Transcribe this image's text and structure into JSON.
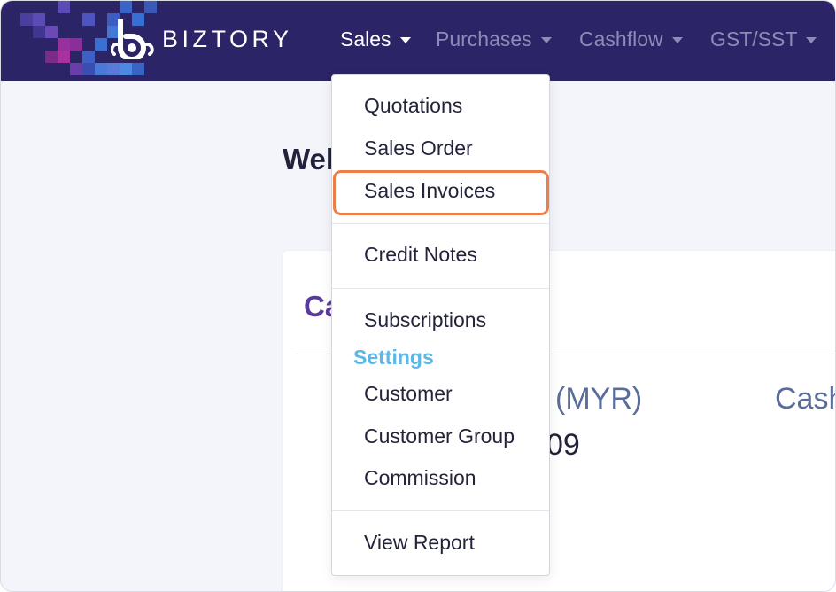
{
  "brand": {
    "name": "BIZTORY",
    "logo_icon": "biztory-b-icon",
    "colors": {
      "navbar": "#2b2466",
      "accent_highlight": "#ec7e4a",
      "settings_header": "#5cb7e6"
    }
  },
  "nav": {
    "items": [
      {
        "label": "Sales",
        "active": true
      },
      {
        "label": "Purchases",
        "active": false
      },
      {
        "label": "Cashflow",
        "active": false
      },
      {
        "label": "GST/SST",
        "active": false
      }
    ],
    "caret_icon": "caret-down-icon"
  },
  "dropdown": {
    "items": [
      {
        "label": "Quotations"
      },
      {
        "label": "Sales Order"
      },
      {
        "label": "Sales Invoices",
        "highlighted": true
      },
      {
        "label": "Credit Notes"
      },
      {
        "label": "Subscriptions"
      }
    ],
    "settings_header": "Settings",
    "settings_items": [
      {
        "label": "Customer"
      },
      {
        "label": "Customer Group"
      },
      {
        "label": "Commission"
      }
    ],
    "report_item": {
      "label": "View Report"
    }
  },
  "background": {
    "welcome_fragment": "Wel",
    "card_title_fragment": "Ca",
    "currency_label_fragment": "(MYR)",
    "cash_label_fragment": "Cash",
    "amount_fragment": "09"
  }
}
